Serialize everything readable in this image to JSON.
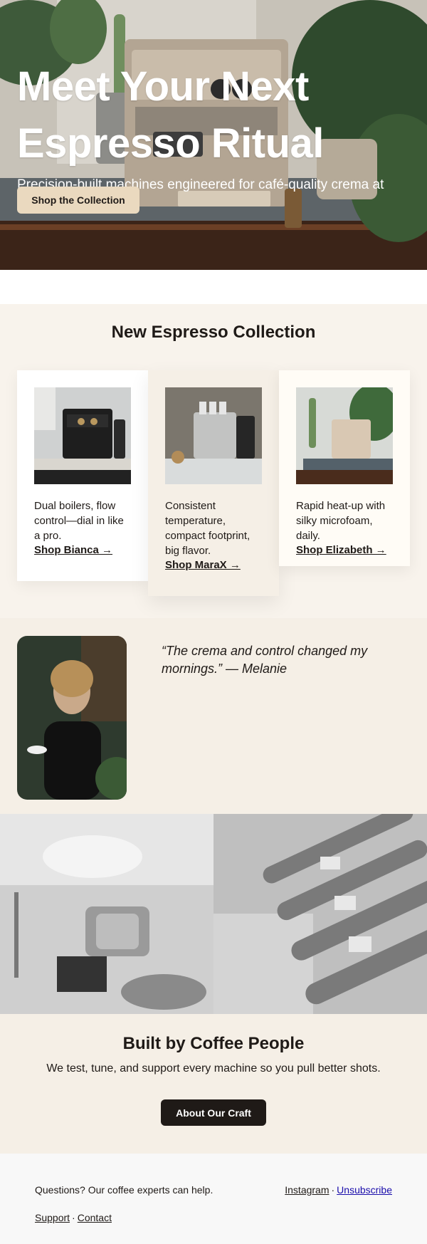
{
  "hero": {
    "title_line1": "Meet Your Next",
    "title_line2": "Espresso Ritual",
    "subtitle": "Precision-built machines engineered for café-quality crema at home.",
    "cta_label": "Shop the Collection"
  },
  "collection": {
    "title": "New Espresso Collection",
    "cards": [
      {
        "desc": "Dual boilers, flow control—dial in like a pro.",
        "link": "Shop Bianca →"
      },
      {
        "desc": "Consistent temperature, compact footprint, big flavor.",
        "link": "Shop MaraX →"
      },
      {
        "desc": "Rapid heat-up with silky microfoam, daily.",
        "link": "Shop Elizabeth →"
      }
    ]
  },
  "testimonial": {
    "quote": "“The crema and control changed my mornings.” — Melanie"
  },
  "craft": {
    "title": "Built by Coffee People",
    "subtitle": "We test, tune, and support every machine so you pull better shots.",
    "cta_label": "About Our Craft"
  },
  "footer": {
    "help_text": "Questions? Our coffee experts can help.",
    "instagram": "Instagram",
    "dot": "·",
    "unsubscribe": "Unsubscribe",
    "support": "Support",
    "contact": "Contact"
  },
  "colors": {
    "hero_button": "#ead9bf",
    "dark": "#1f1a17",
    "section_bg": "#f5efe6"
  }
}
